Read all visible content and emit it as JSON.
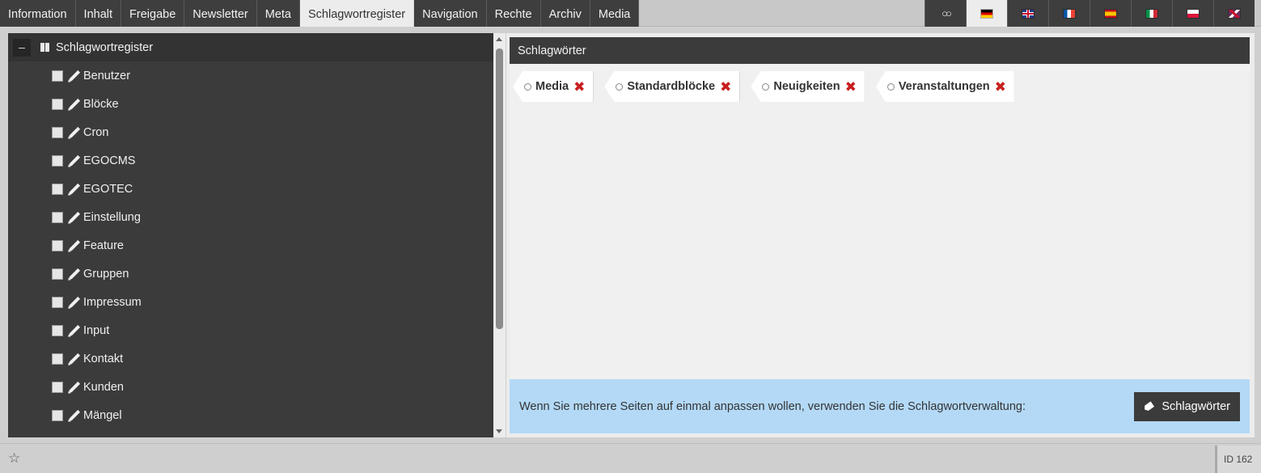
{
  "tabs": [
    {
      "label": "Information"
    },
    {
      "label": "Inhalt"
    },
    {
      "label": "Freigabe"
    },
    {
      "label": "Newsletter"
    },
    {
      "label": "Meta"
    },
    {
      "label": "Schlagwortregister",
      "active": true
    },
    {
      "label": "Navigation"
    },
    {
      "label": "Rechte"
    },
    {
      "label": "Archiv"
    },
    {
      "label": "Media"
    }
  ],
  "languages": [
    {
      "icon": "link-icon"
    },
    {
      "icon": "flag-de-icon",
      "active": true
    },
    {
      "icon": "flag-en-icon"
    },
    {
      "icon": "flag-fr-icon"
    },
    {
      "icon": "flag-es-icon"
    },
    {
      "icon": "flag-it-icon"
    },
    {
      "icon": "flag-pl-icon"
    },
    {
      "icon": "flag-multi-icon"
    }
  ],
  "tree": {
    "root_label": "Schlagwortregister",
    "collapse_symbol": "–",
    "items": [
      {
        "label": "Benutzer"
      },
      {
        "label": "Blöcke"
      },
      {
        "label": "Cron"
      },
      {
        "label": "EGOCMS"
      },
      {
        "label": "EGOTEC"
      },
      {
        "label": "Einstellung"
      },
      {
        "label": "Feature"
      },
      {
        "label": "Gruppen"
      },
      {
        "label": "Impressum"
      },
      {
        "label": "Input"
      },
      {
        "label": "Kontakt"
      },
      {
        "label": "Kunden"
      },
      {
        "label": "Mängel"
      }
    ]
  },
  "keywords": {
    "header": "Schlagwörter",
    "tags": [
      {
        "label": "Media"
      },
      {
        "label": "Standardblöcke"
      },
      {
        "label": "Neuigkeiten"
      },
      {
        "label": "Veranstaltungen"
      }
    ],
    "remove_symbol": "✖"
  },
  "info": {
    "text": "Wenn Sie mehrere Seiten auf einmal anpassen wollen, verwenden Sie die Schlagwortverwaltung:",
    "button_label": "Schlagwörter"
  },
  "status": {
    "star_symbol": "☆",
    "page_id": "ID 162"
  }
}
